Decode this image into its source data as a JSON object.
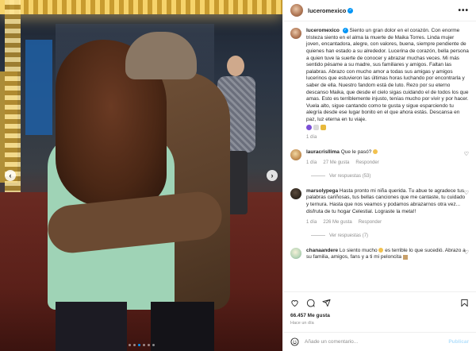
{
  "post": {
    "username": "luceromexico",
    "more_label": "•••"
  },
  "caption": {
    "username": "luceromexico",
    "text": "Siento un gran dolor en el corazón. Con enorme tristeza siento en el alma la muerte de Maika Torres. Linda mujer joven, encantadora, alegre, con valores, buena, siempre pendiente de quienes han estado a su alrededor. Lucerina de corazón, bella persona a quien tuve la suerte de conocer y abrazar muchas veces. Mi más sentido pésame a su madre, sus familiares y amigos. Faltan las palabras. Abrazo con mucho amor a todas sus amigas y amigos lucerinos que estuvieron las últimas horas luchando por encontrarla y saber de ella. Nuestro fandom está de luto. Rezo por su eterno descanso Maika, que desde el cielo sigas cuidando el de todos los que amas. Esto es terriblemente injusto, tenías mucho por vivir y por hacer. Vuela alto, sigue cantando como te gusta y sigue esparciendo tu alegría desde ese lugar bonito en el que ahora estás. Descansa en paz, luz eterna en tu viaje.",
    "time": "1 día",
    "emoji_colors": [
      "#7b4fd6",
      "#3b3b3b",
      "#e8b93b"
    ]
  },
  "comments": [
    {
      "username": "lauracrisllima",
      "text": "Que le pasó?",
      "time": "1 día",
      "likes": "27 Me gusta",
      "reply": "Responder",
      "replies": "Ver respuestas (53)",
      "trailing_emoji_color": "#f2c14e"
    },
    {
      "username": "marsolypega",
      "text": "Hasta pronto mi niña querida. Tu abue te agradece tus palabras cariñosas, tus bellas canciones que me cantaste, tu cuidado y ternura. Hasta que nos veamos y podamos abrazarnos otra vez... disfruta de tu hogar Celestial. Lograste la meta!!",
      "time": "1 día",
      "likes": "226 Me gusta",
      "reply": "Responder",
      "replies": "Ver respuestas (7)"
    },
    {
      "username": "chanaandere",
      "text": "Lo siento mucho",
      "text2": "es terrible lo que sucedió. Abrazo a su familia, amigos, fans y a ti mi peloncita"
    }
  ],
  "actions": {
    "likes": "66.457 Me gusta",
    "time": "Hace un día"
  },
  "composer": {
    "placeholder": "Añade un comentario...",
    "publish": "Publicar"
  },
  "carousel": {
    "total": 6,
    "active": 2
  },
  "colors": {
    "accent": "#0095f6",
    "heart": "#ed4956"
  }
}
